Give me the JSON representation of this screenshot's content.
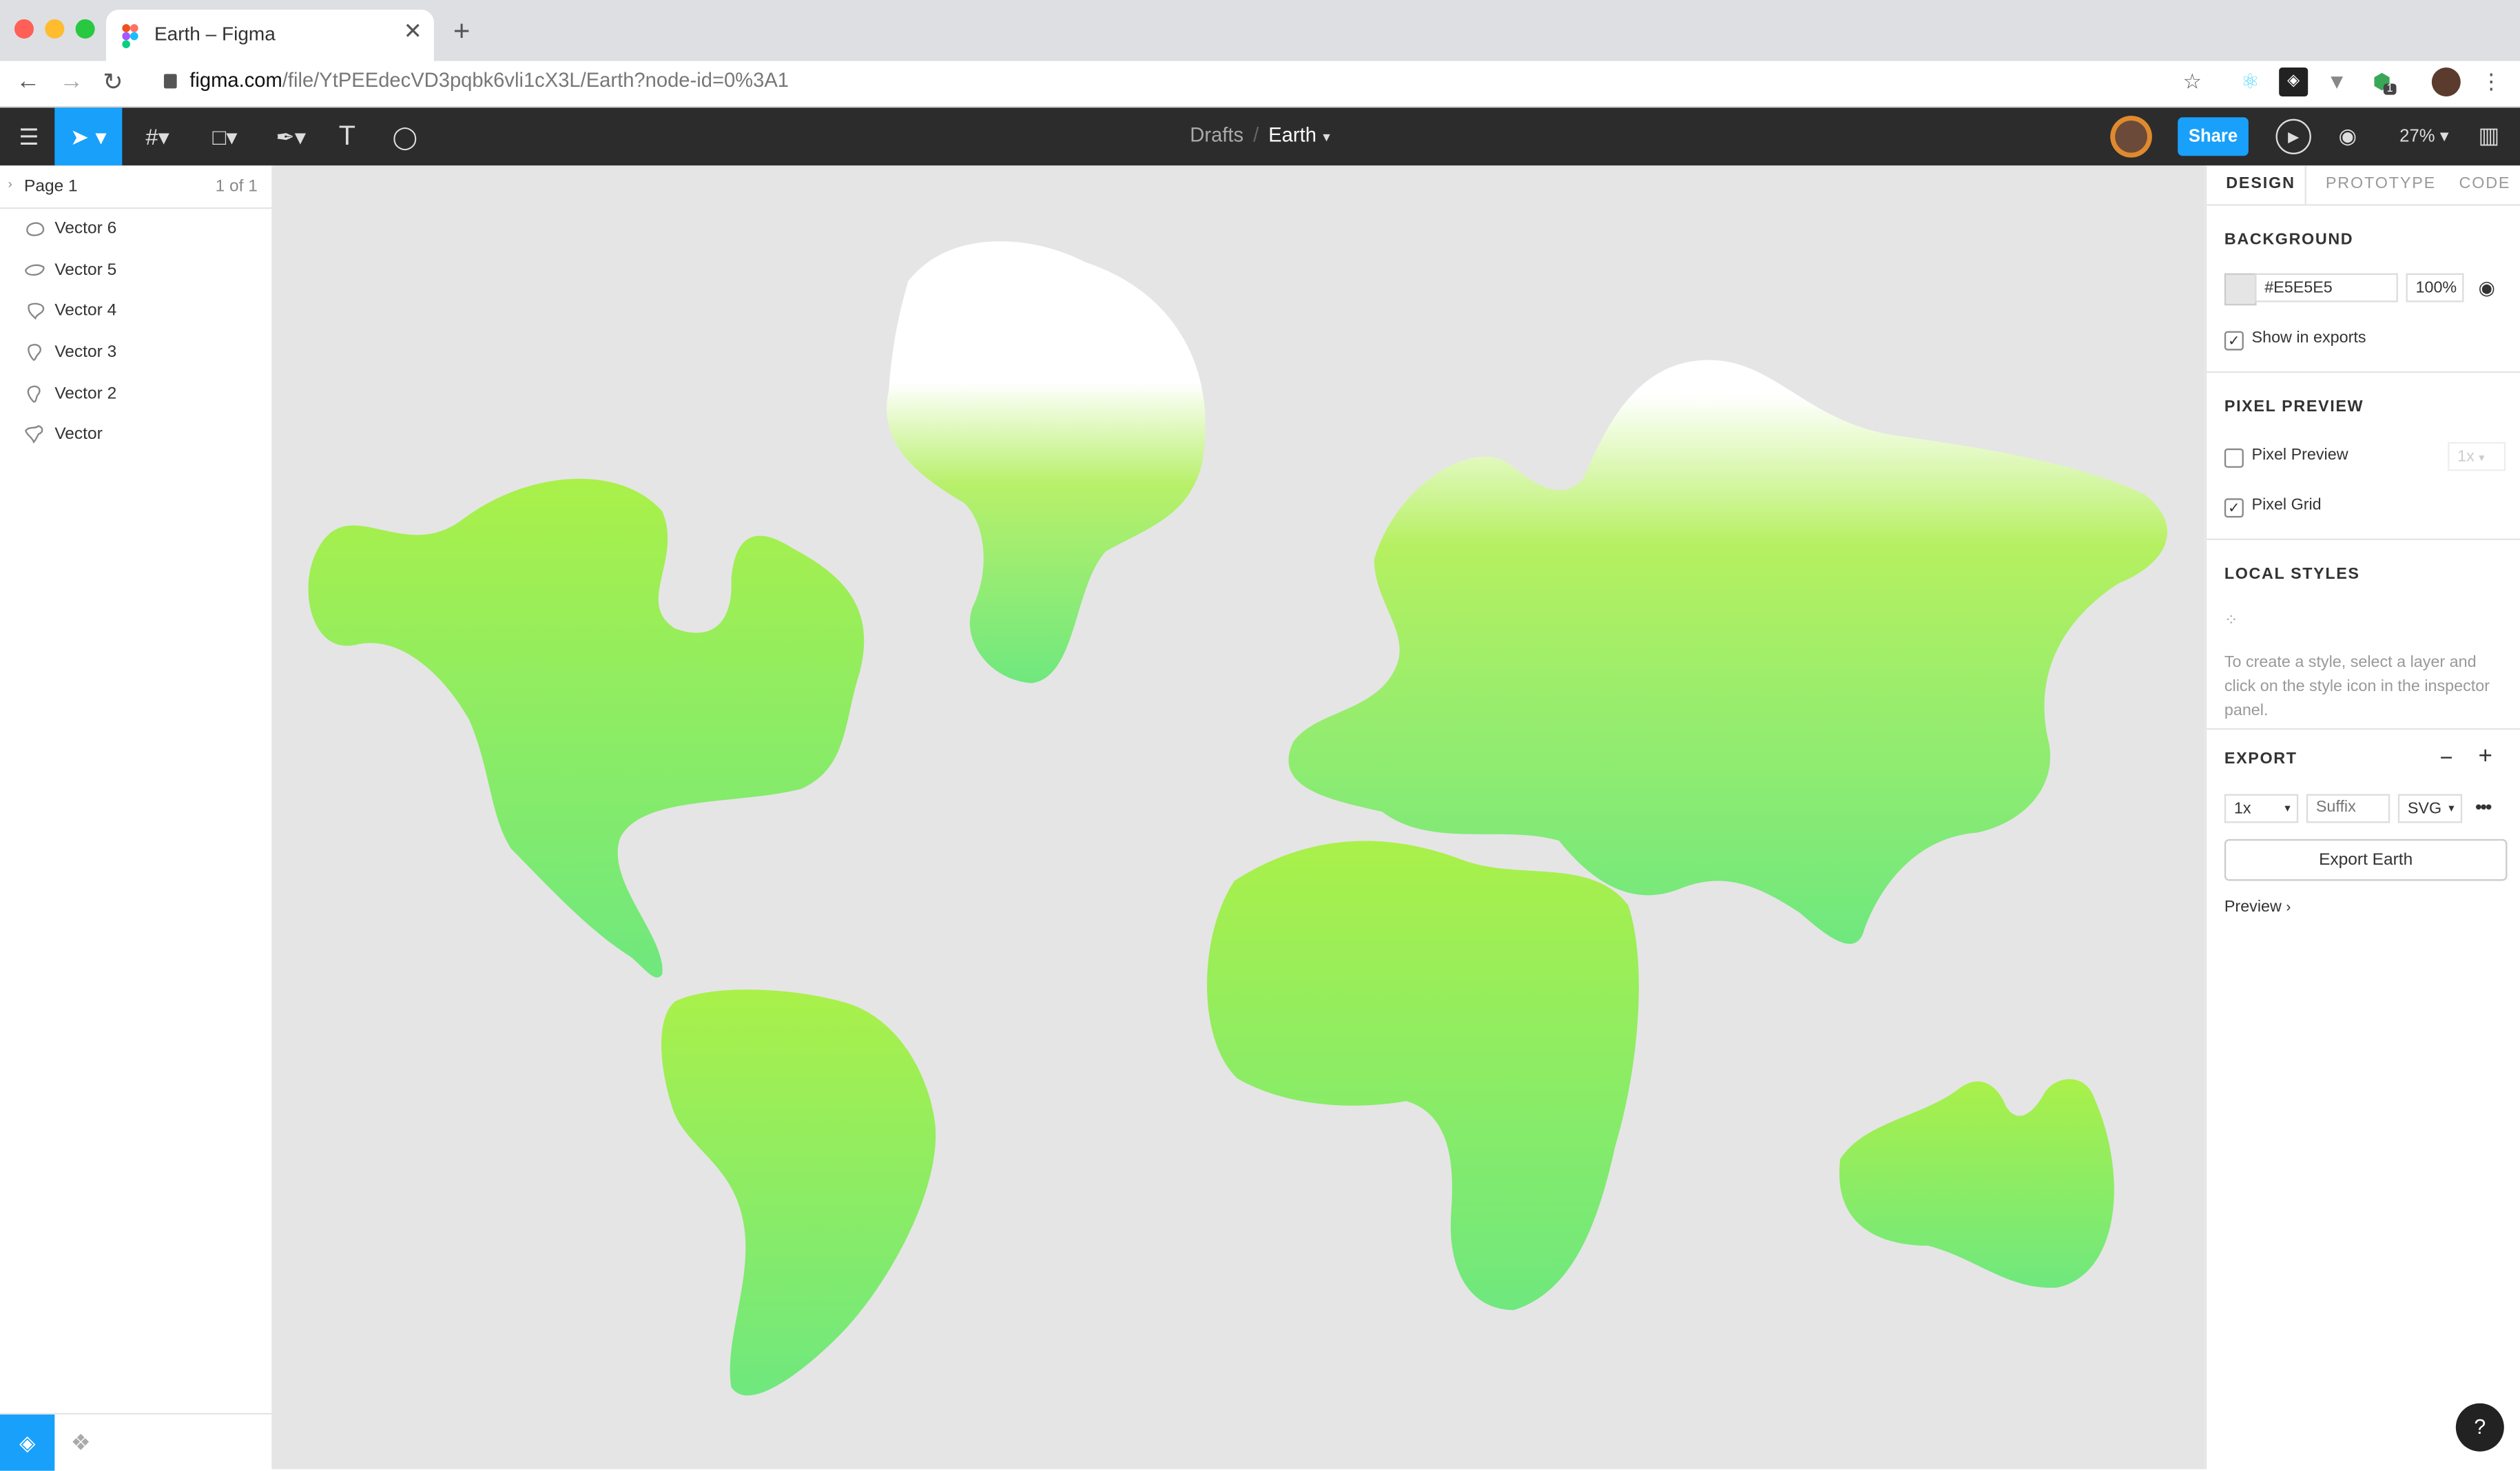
{
  "browser": {
    "tab_title": "Earth – Figma",
    "url_host": "figma.com",
    "url_path": "/file/YtPEEdecVD3pqbk6vli1cX3L/Earth?node-id=0%3A1",
    "extension_badge": "1"
  },
  "toolbar": {
    "breadcrumb_drafts": "Drafts",
    "breadcrumb_sep": "/",
    "file_name": "Earth",
    "share_label": "Share",
    "zoom": "27%"
  },
  "layers_panel": {
    "page_name": "Page 1",
    "page_count": "1 of 1",
    "layers": [
      "Vector 6",
      "Vector 5",
      "Vector 4",
      "Vector 3",
      "Vector 2",
      "Vector"
    ]
  },
  "design_panel": {
    "tabs": [
      "DESIGN",
      "PROTOTYPE",
      "CODE"
    ],
    "background": {
      "title": "BACKGROUND",
      "hex": "#E5E5E5",
      "opacity": "100%",
      "show_in_exports_label": "Show in exports",
      "show_in_exports": true
    },
    "pixel_preview": {
      "title": "PIXEL PREVIEW",
      "pixel_preview_label": "Pixel Preview",
      "pixel_preview_checked": false,
      "scale": "1x",
      "pixel_grid_label": "Pixel Grid",
      "pixel_grid_checked": true
    },
    "local_styles": {
      "title": "LOCAL STYLES",
      "hint": "To create a style, select a layer and click on the style icon in the inspector panel."
    },
    "export": {
      "title": "EXPORT",
      "scale": "1x",
      "suffix_placeholder": "Suffix",
      "format": "SVG",
      "button_label": "Export Earth",
      "preview_label": "Preview"
    }
  },
  "help_label": "?",
  "colors": {
    "canvas_bg": "#e5e5e5",
    "accent": "#18a0fb",
    "toolbar_bg": "#2c2c2c",
    "land_top": "#aaf04a",
    "land_bottom": "#6fe87e",
    "ice": "#ffffff"
  }
}
